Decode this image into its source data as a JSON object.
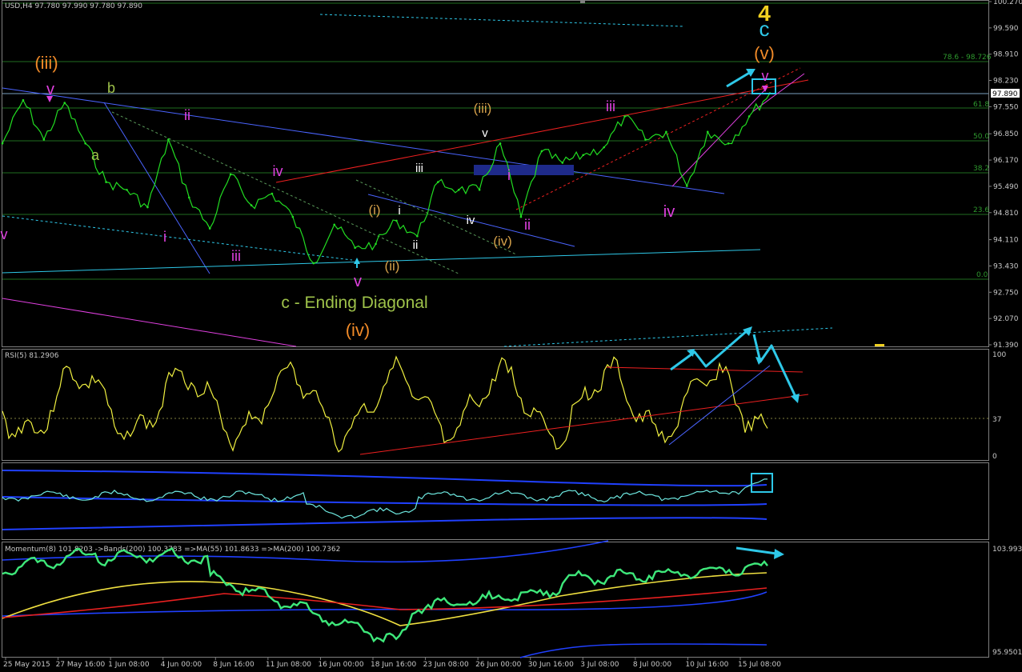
{
  "header": {
    "symbol_line": "USD,H4  97.780 97.990 97.780 97.890"
  },
  "price_axis": {
    "ticks": [
      "100.270",
      "99.590",
      "98.910",
      "98.230",
      "97.550",
      "96.850",
      "96.170",
      "95.490",
      "94.810",
      "94.110",
      "93.430",
      "92.750",
      "92.070",
      "91.390"
    ],
    "current_price": "97.890"
  },
  "fib_labels": [
    "78.6 - 98.726",
    "61.8",
    "50.0",
    "38.2",
    "23.6",
    "0.0"
  ],
  "wave_labels": [
    {
      "text": "(iii)",
      "color": "#f08a28"
    },
    {
      "text": "v",
      "color": "#e040e0"
    },
    {
      "text": "b",
      "color": "#9ec24a"
    },
    {
      "text": "a",
      "color": "#9ec24a"
    },
    {
      "text": "ii",
      "color": "#e040e0"
    },
    {
      "text": "i",
      "color": "#e040e0"
    },
    {
      "text": "iii",
      "color": "#e040e0"
    },
    {
      "text": "iv",
      "color": "#e040e0"
    },
    {
      "text": "v",
      "color": "#e040e0"
    },
    {
      "text": "v",
      "color": "#e040e0"
    },
    {
      "text": "c - Ending Diagonal",
      "color": "#9ec24a"
    },
    {
      "text": "(iv)",
      "color": "#f08a28"
    },
    {
      "text": "(i)",
      "color": "#d4a04a"
    },
    {
      "text": "(ii)",
      "color": "#d4a04a"
    },
    {
      "text": "(iii)",
      "color": "#d4a04a"
    },
    {
      "text": "(iv)",
      "color": "#d4a04a"
    },
    {
      "text": "i",
      "color": "#ffffff"
    },
    {
      "text": "ii",
      "color": "#ffffff"
    },
    {
      "text": "iii",
      "color": "#ffffff"
    },
    {
      "text": "iv",
      "color": "#ffffff"
    },
    {
      "text": "v",
      "color": "#ffffff"
    },
    {
      "text": "i",
      "color": "#e040e0"
    },
    {
      "text": "ii",
      "color": "#e040e0"
    },
    {
      "text": "iii",
      "color": "#e040e0"
    },
    {
      "text": "iv",
      "color": "#e040e0"
    },
    {
      "text": "v",
      "color": "#e040e0"
    },
    {
      "text": "(v)",
      "color": "#f08a28"
    },
    {
      "text": "c",
      "color": "#2ec8e8"
    },
    {
      "text": "4",
      "color": "#f0d020"
    }
  ],
  "rsi": {
    "label": "RSI(5) 81.2906",
    "ticks": [
      "100",
      "37",
      "0"
    ]
  },
  "momentum": {
    "label": "Momentum(8) 101.8203  ->Bands(200) 100.3783  =>MA(55) 101.8633  =>MA(200) 100.7362",
    "ticks": [
      "103.9939",
      "95.9501"
    ]
  },
  "time_axis": [
    "25 May 2015",
    "27 May 16:00",
    "1 Jun 08:00",
    "4 Jun 00:00",
    "8 Jun 16:00",
    "11 Jun 08:00",
    "16 Jun 00:00",
    "18 Jun 16:00",
    "23 Jun 08:00",
    "26 Jun 00:00",
    "30 Jun 16:00",
    "3 Jul 08:00",
    "8 Jul 00:00",
    "10 Jul 16:00",
    "15 Jul 08:00"
  ],
  "chart_data": {
    "type": "line",
    "x_start": "25 May 2015",
    "x_end": "16 Jul 2015",
    "ylim": [
      91.39,
      100.27
    ],
    "grid": false,
    "anchors": [
      {
        "time": "25 May 2015",
        "price": 96.6
      },
      {
        "time": "27 May 16:00",
        "price": 97.72
      },
      {
        "time": "29 May 08:00",
        "price": 96.7
      },
      {
        "time": "1 Jun 08:00",
        "price": 97.65
      },
      {
        "time": "2 Jun 00:00",
        "price": 96.6
      },
      {
        "time": "3 Jun 08:00",
        "price": 95.6
      },
      {
        "time": "4 Jun 00:00",
        "price": 95.4
      },
      {
        "time": "4 Jun 16:00",
        "price": 94.95
      },
      {
        "time": "5 Jun 08:00",
        "price": 96.7
      },
      {
        "time": "8 Jun 16:00",
        "price": 95.2
      },
      {
        "time": "9 Jun 16:00",
        "price": 94.4
      },
      {
        "time": "10 Jun 16:00",
        "price": 95.8
      },
      {
        "time": "11 Jun 08:00",
        "price": 95.0
      },
      {
        "time": "12 Jun 08:00",
        "price": 95.3
      },
      {
        "time": "16 Jun 00:00",
        "price": 94.7
      },
      {
        "time": "16 Jun 16:00",
        "price": 93.5
      },
      {
        "time": "17 Jun 08:00",
        "price": 94.5
      },
      {
        "time": "18 Jun 08:00",
        "price": 93.9
      },
      {
        "time": "18 Jun 16:00",
        "price": 94.0
      },
      {
        "time": "19 Jun 08:00",
        "price": 94.6
      },
      {
        "time": "22 Jun 16:00",
        "price": 94.2
      },
      {
        "time": "23 Jun 08:00",
        "price": 95.6
      },
      {
        "time": "24 Jun 08:00",
        "price": 95.4
      },
      {
        "time": "26 Jun 00:00",
        "price": 95.4
      },
      {
        "time": "26 Jun 16:00",
        "price": 96.6
      },
      {
        "time": "29 Jun 16:00",
        "price": 94.7
      },
      {
        "time": "30 Jun 16:00",
        "price": 96.4
      },
      {
        "time": "1 Jul 16:00",
        "price": 96.1
      },
      {
        "time": "3 Jul 08:00",
        "price": 96.3
      },
      {
        "time": "6 Jul 08:00",
        "price": 96.5
      },
      {
        "time": "7 Jul 16:00",
        "price": 97.3
      },
      {
        "time": "8 Jul 08:00",
        "price": 96.7
      },
      {
        "time": "9 Jul 16:00",
        "price": 96.9
      },
      {
        "time": "10 Jul 08:00",
        "price": 95.5
      },
      {
        "time": "13 Jul 16:00",
        "price": 96.9
      },
      {
        "time": "14 Jul 16:00",
        "price": 96.6
      },
      {
        "time": "15 Jul 08:00",
        "price": 97.3
      },
      {
        "time": "16 Jul 00:00",
        "price": 97.9
      }
    ]
  },
  "colors": {
    "price": "#22dd22",
    "fib": "#1f6e1f",
    "blue_line": "#4a64ff",
    "red_line": "#ee2020",
    "cyan": "#2ec8e8",
    "rsi": "#f0f040",
    "mom_green": "#3ee87a",
    "ma_yellow": "#f0e040",
    "ma_red": "#e82020",
    "band_blue": "#2040ff"
  }
}
